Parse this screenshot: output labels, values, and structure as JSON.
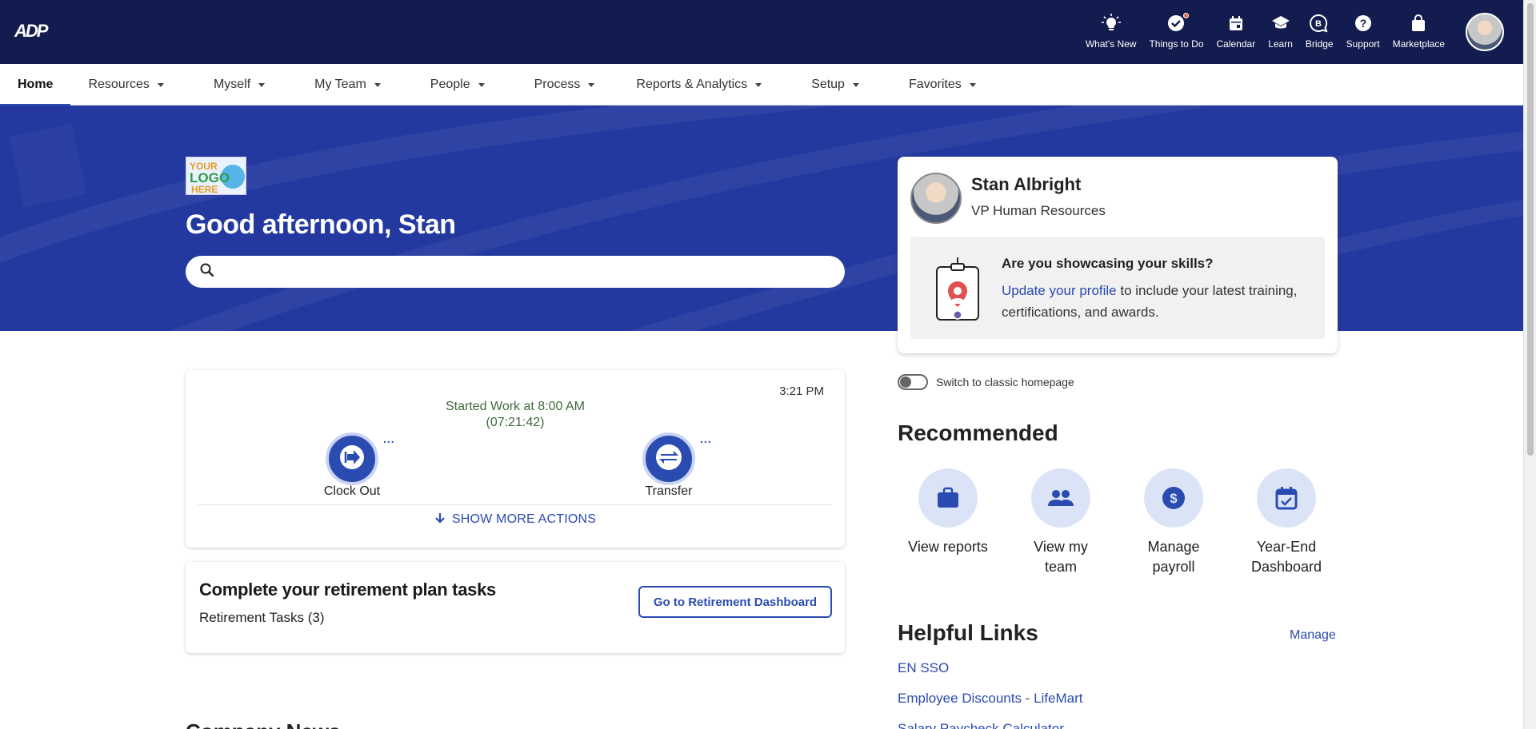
{
  "topbar": {
    "logo": "ADP",
    "actions": [
      {
        "label": "What's New",
        "icon": "lightbulb-icon"
      },
      {
        "label": "Things to Do",
        "icon": "check-circle-icon"
      },
      {
        "label": "Calendar",
        "icon": "calendar-icon"
      },
      {
        "label": "Learn",
        "icon": "graduation-cap-icon"
      },
      {
        "label": "Bridge",
        "icon": "bridge-icon"
      },
      {
        "label": "Support",
        "icon": "help-icon"
      },
      {
        "label": "Marketplace",
        "icon": "shopping-bag-icon"
      }
    ]
  },
  "nav": {
    "items": [
      "Home",
      "Resources",
      "Myself",
      "My Team",
      "People",
      "Process",
      "Reports & Analytics",
      "Setup",
      "Favorites"
    ]
  },
  "hero": {
    "logo_lines": [
      "YOUR",
      "LOGO",
      "HERE"
    ],
    "greeting": "Good afternoon, Stan",
    "search_placeholder": ""
  },
  "profile": {
    "name": "Stan Albright",
    "title": "VP Human Resources",
    "skills_question": "Are you showcasing your skills?",
    "skills_link": "Update your profile",
    "skills_text": " to include your latest training, certifications, and awards."
  },
  "clock": {
    "time": "3:21 PM",
    "started": "Started Work at 8:00 AM",
    "elapsed": "(07:21:42)",
    "clock_out": "Clock Out",
    "transfer": "Transfer",
    "more": "...",
    "show_more": "SHOW MORE ACTIONS"
  },
  "retirement": {
    "title": "Complete your retirement plan tasks",
    "tasks": "Retirement Tasks (3)",
    "button": "Go to Retirement Dashboard"
  },
  "peek_title": "Company News",
  "toggle_label": "Switch to classic homepage",
  "recommended": {
    "title": "Recommended",
    "items": [
      {
        "label": "View reports",
        "icon": "briefcase-icon"
      },
      {
        "label": "View my team",
        "icon": "people-icon"
      },
      {
        "label": "Manage payroll",
        "icon": "dollar-icon"
      },
      {
        "label": "Year-End Dashboard",
        "icon": "calendar-check-icon"
      }
    ]
  },
  "helpful_links": {
    "title": "Helpful Links",
    "manage": "Manage",
    "links": [
      "EN SSO",
      "Employee Discounts - LifeMart",
      "Salary Paycheck Calculator"
    ]
  },
  "colors": {
    "topbar": "#121c4e",
    "hero": "#2439a0",
    "accent": "#2a4bb0",
    "started_text": "#3d6b39"
  }
}
